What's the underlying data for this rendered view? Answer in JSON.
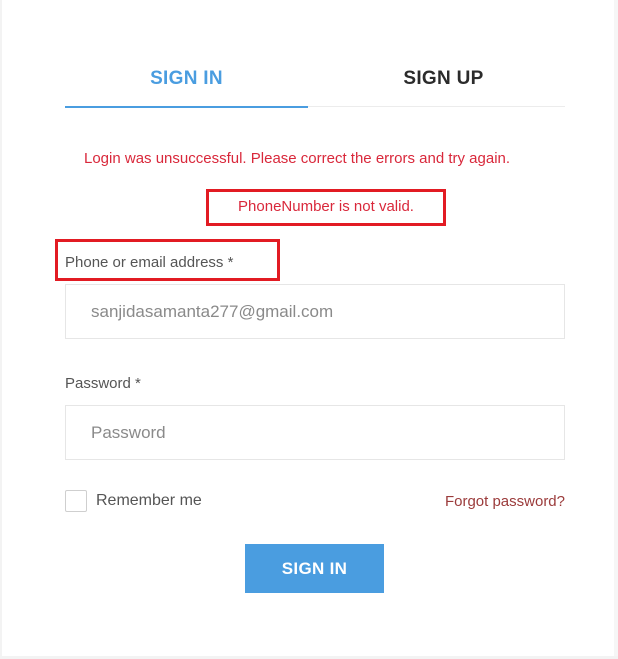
{
  "tabs": {
    "signin_label": "SIGN IN",
    "signup_label": "SIGN UP"
  },
  "errors": {
    "summary": "Login was unsuccessful. Please correct the errors and try again.",
    "phone": "PhoneNumber is not valid."
  },
  "form": {
    "phone_label": "Phone or email address *",
    "phone_value": "sanjidasamanta277@gmail.com",
    "password_label": "Password *",
    "password_placeholder": "Password",
    "remember_label": "Remember me",
    "remember_checked": false,
    "forgot_label": "Forgot password?",
    "submit_label": "SIGN IN"
  },
  "colors": {
    "accent": "#4a9de0",
    "error": "#d9283b",
    "highlight_box": "#e21b23",
    "link": "#9b3b3b"
  }
}
